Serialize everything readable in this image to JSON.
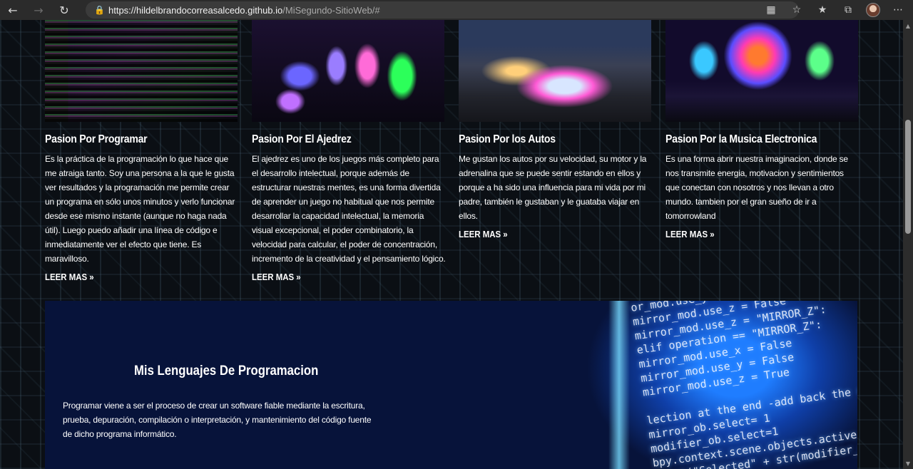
{
  "browser": {
    "url_host": "https://hildelbrandocorreasalcedo.github.io",
    "url_path": "/MiSegundo-SitioWeb/#"
  },
  "cards": [
    {
      "title": "Pasion Por Programar",
      "text": "Es la práctica de la programación lo que hace que me atraiga tanto. Soy una persona a la que le gusta ver resultados y la programación me permite crear un programa en sólo unos minutos y verlo funcionar desde ese mismo instante (aunque no haga nada útil). Luego puedo añadir una línea de código e inmediatamente ver el efecto que tiene. Es maravilloso.",
      "more": "LEER MAS »"
    },
    {
      "title": "Pasion Por El Ajedrez",
      "text": "El ajedrez es uno de los juegos más completo para el desarrollo intelectual, porque además de estructurar nuestras mentes, es una forma divertida de aprender un juego no habitual que nos permite desarrollar la capacidad intelectual, la memoria visual excepcional, el poder combinatorio, la velocidad para calcular, el poder de concentración, incremento de la creatividad y el pensamiento lógico.",
      "more": "LEER MAS »"
    },
    {
      "title": "Pasion Por los Autos",
      "text": "Me gustan los autos por su velocidad, su motor y la adrenalina que se puede sentir estando en ellos y porque a ha sido una influencia para mi vida por mi padre, también le gustaban y le guataba viajar en ellos.",
      "more": "LEER MAS »"
    },
    {
      "title": "Pasion Por la Musica Electronica",
      "text": "Es una forma abrir nuestra imaginacion, donde se nos transmite energia, motivacion y sentimientos que conectan con nosotros y nos llevan a otro mundo. tambien por el gran sueño de ir a tomorrowland",
      "more": "LEER MAS »"
    }
  ],
  "banner": {
    "title": "Mis Lenguajes De Programacion",
    "text": "Programar viene a ser el proceso de crear un software fiable mediante la escritura, prueba, depuración, compilación o interpretación, y mantenimiento del código fuente de dicho programa informático.",
    "code": [
      "or_mod.use_y = True",
      "mirror_mod.use_z = False",
      "mirror_mod.use_z = \"MIRROR_Z\":",
      "elif operation == \"MIRROR_Z\":",
      "mirror_mod.use_x = False",
      "mirror_mod.use_y = False",
      "mirror_mod.use_z = True",
      "",
      "lection at the end -add back the deselecte",
      "mirror_ob.select= 1",
      "modifier_ob.select=1",
      "bpy.context.scene.objects.active = modifier_ob",
      "print(\"Selected\" + str(modifier_ob)) # modifier o"
    ]
  }
}
